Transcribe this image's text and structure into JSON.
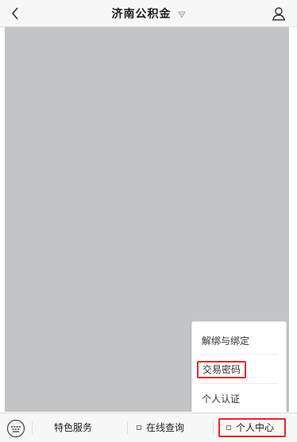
{
  "header": {
    "title": "济南公积金"
  },
  "popup_menu": {
    "items": [
      {
        "label": "解绑与绑定"
      },
      {
        "label": "交易密码"
      },
      {
        "label": "个人认证"
      }
    ]
  },
  "tabbar": {
    "tabs": [
      {
        "label": "特色服务"
      },
      {
        "label": "在线查询"
      },
      {
        "label": "个人中心"
      }
    ]
  },
  "colors": {
    "highlight": "#e8262c",
    "content_gray": "#c3c4c6"
  },
  "icons": [
    "back-icon",
    "verified-icon",
    "user-icon",
    "keyboard-icon",
    "menu-dot-icon"
  ]
}
